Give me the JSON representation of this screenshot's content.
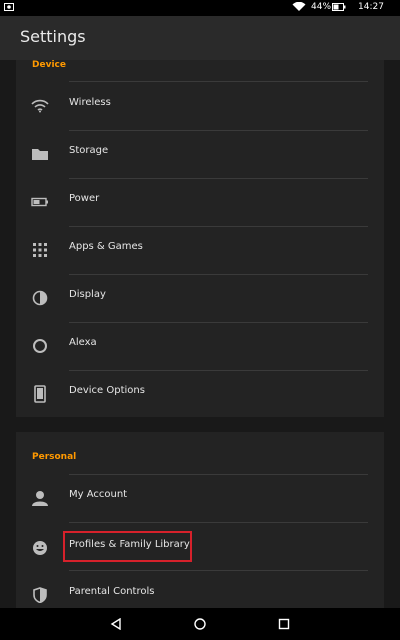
{
  "status_bar": {
    "battery_percent": "44%",
    "time": "14:27"
  },
  "app_bar": {
    "title": "Settings"
  },
  "sections": {
    "device": {
      "header": "Device",
      "items": [
        {
          "label": "Wireless",
          "icon": "wifi-icon"
        },
        {
          "label": "Storage",
          "icon": "folder-icon"
        },
        {
          "label": "Power",
          "icon": "battery-icon"
        },
        {
          "label": "Apps & Games",
          "icon": "apps-grid-icon"
        },
        {
          "label": "Display",
          "icon": "display-contrast-icon"
        },
        {
          "label": "Alexa",
          "icon": "alexa-icon"
        },
        {
          "label": "Device Options",
          "icon": "device-icon"
        }
      ]
    },
    "personal": {
      "header": "Personal",
      "items": [
        {
          "label": "My Account",
          "icon": "account-icon"
        },
        {
          "label": "Profiles & Family Library",
          "icon": "profiles-smiley-icon"
        },
        {
          "label": "Parental Controls",
          "icon": "shield-icon"
        }
      ]
    }
  },
  "colors": {
    "accent": "#ff9900",
    "highlight_border": "#d6212b",
    "background": "#191919",
    "card": "#232323"
  }
}
